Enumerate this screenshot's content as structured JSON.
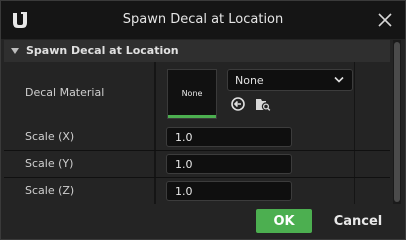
{
  "dialog": {
    "title": "Spawn Decal at Location",
    "logo_icon": "unreal-logo-icon",
    "close_icon": "close-icon"
  },
  "section": {
    "title": "Spawn Decal at Location",
    "expanded": true
  },
  "properties": {
    "decal_material": {
      "label": "Decal Material",
      "thumbnail_text": "None",
      "selected_value": "None",
      "use_selected_icon": "use-selected-arrow-icon",
      "browse_icon": "browse-folder-icon"
    },
    "scale_x": {
      "label": "Scale (X)",
      "value": "1.0"
    },
    "scale_y": {
      "label": "Scale (Y)",
      "value": "1.0"
    },
    "scale_z": {
      "label": "Scale (Z)",
      "value": "1.0"
    }
  },
  "buttons": {
    "ok": "OK",
    "cancel": "Cancel"
  },
  "colors": {
    "accent_green": "#4caf50",
    "titlebar_bg": "#151515",
    "panel_bg": "#242424"
  }
}
